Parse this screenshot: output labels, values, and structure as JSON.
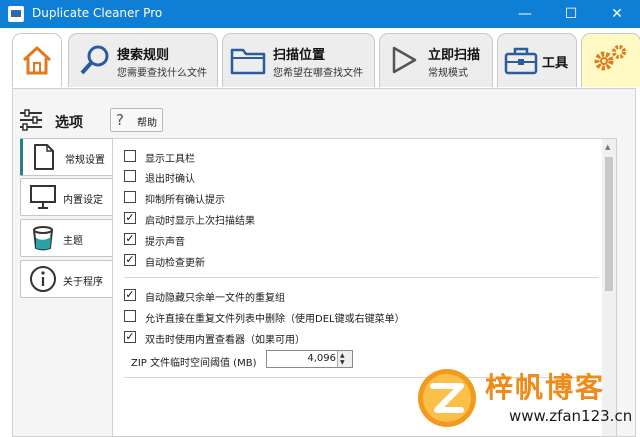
{
  "window": {
    "title": "Duplicate Cleaner Pro",
    "minimize": "—",
    "maximize": "☐",
    "close": "✕"
  },
  "tabs": [
    {
      "id": "home",
      "icon": "home-icon"
    },
    {
      "id": "search-rules",
      "title": "搜索规则",
      "subtitle": "您需要查找什么文件",
      "icon": "magnifier-icon"
    },
    {
      "id": "scan-location",
      "title": "扫描位置",
      "subtitle": "您希望在哪查找文件",
      "icon": "folder-icon"
    },
    {
      "id": "scan-now",
      "title": "立即扫描",
      "subtitle": "常规模式",
      "icon": "play-icon"
    },
    {
      "id": "tools",
      "title": "工具",
      "icon": "toolbox-icon"
    },
    {
      "id": "settings",
      "icon": "gears-icon"
    }
  ],
  "header": {
    "title": "选项",
    "help_label": "帮助"
  },
  "sidebar": {
    "items": [
      {
        "label": "常规设置",
        "icon": "document-icon",
        "active": true
      },
      {
        "label": "内置设定",
        "icon": "monitor-icon",
        "active": false
      },
      {
        "label": "主题",
        "icon": "paint-bucket-icon",
        "active": false
      },
      {
        "label": "关于程序",
        "icon": "info-icon",
        "active": false
      }
    ]
  },
  "options": {
    "group1": [
      {
        "label": "显示工具栏",
        "checked": false
      },
      {
        "label": "退出时确认",
        "checked": false
      },
      {
        "label": "抑制所有确认提示",
        "checked": false
      },
      {
        "label": "启动时显示上次扫描结果",
        "checked": true
      },
      {
        "label": "提示声音",
        "checked": true
      },
      {
        "label": "自动检查更新",
        "checked": true
      }
    ],
    "group2": [
      {
        "label": "自动隐藏只余单一文件的重复组",
        "checked": true
      },
      {
        "label": "允许直接在重复文件列表中删除（使用DEL键或右键菜单）",
        "checked": false
      },
      {
        "label": "双击时使用内置查看器（如果可用）",
        "checked": true
      }
    ],
    "zip_label": "ZIP 文件临时空间阈值 (MB)",
    "zip_value": "4,096"
  },
  "watermark": {
    "line1": "梓帆博客",
    "line2": "www.zfan123.cn"
  },
  "colors": {
    "titlebar": "#0f7fd6",
    "home_icon": "#e07a1f",
    "settings_tab": "#fff9c4",
    "accent": "#2a7e88",
    "watermark_orange": "#f08a18"
  }
}
